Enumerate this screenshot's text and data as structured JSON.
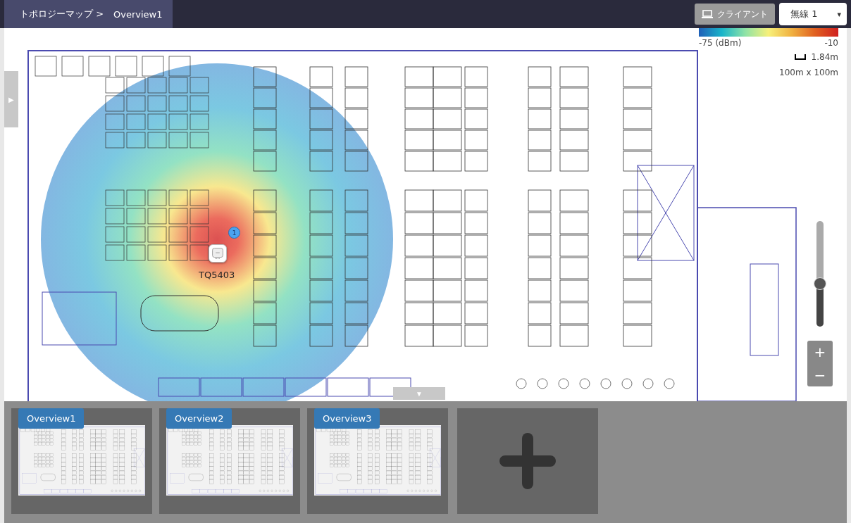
{
  "breadcrumb": {
    "root": "トポロジーマップ >",
    "current": "Overview1"
  },
  "client_button": {
    "label": "クライアント"
  },
  "radio_select": {
    "value": "無線 1",
    "caret": "▾"
  },
  "legend": {
    "min": "-75 (dBm)",
    "max": "-10",
    "scale": "1.84m",
    "map_size": "100m x 100m"
  },
  "side_toggle": "▶",
  "panel_toggle": "▼",
  "access_point": {
    "name": "TQ5403",
    "client_count": "1"
  },
  "zoom": {
    "level": 0.41,
    "plus": "+",
    "minus": "−"
  },
  "maps": [
    {
      "label": "Overview1"
    },
    {
      "label": "Overview2"
    },
    {
      "label": "Overview3"
    }
  ]
}
